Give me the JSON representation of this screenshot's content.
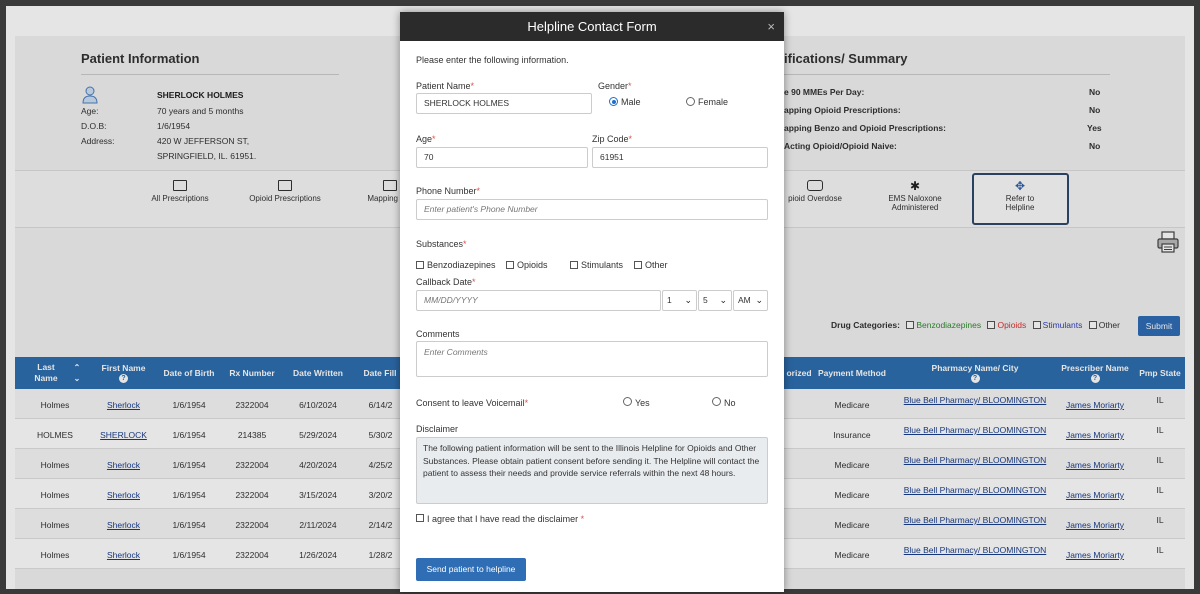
{
  "patient_info": {
    "title": "Patient Information",
    "name": "SHERLOCK HOLMES",
    "age_label": "Age:",
    "age_value": "70 years and 5 months",
    "dob_label": "D.O.B:",
    "dob_value": "1/6/1954",
    "address_label": "Address:",
    "address_line1": "420 W JEFFERSON ST,",
    "address_line2": "SPRINGFIELD, IL. 61951."
  },
  "summary": {
    "title": "ifications/ Summary",
    "rows": [
      {
        "label": "e 90 MMEs Per Day:",
        "value": "No"
      },
      {
        "label": "apping Opioid Prescriptions:",
        "value": "No"
      },
      {
        "label": "apping Benzo and Opioid Prescriptions:",
        "value": "Yes"
      },
      {
        "label": "Acting Opioid/Opioid Naive:",
        "value": "No"
      }
    ]
  },
  "toolbar": {
    "items": [
      {
        "label": "All Prescriptions"
      },
      {
        "label": "Opioid Prescriptions"
      },
      {
        "label": "Mapping Pre"
      },
      {
        "label": "pioid Overdose"
      },
      {
        "label_line1": "EMS Naloxone",
        "label_line2": "Administered"
      },
      {
        "label_line1": "Refer to",
        "label_line2": "Helpline"
      }
    ]
  },
  "filters": {
    "label": "Drug Categories:",
    "options": [
      {
        "label": "Benzodiazepines",
        "color": "#2e8b2e"
      },
      {
        "label": "Opioids",
        "color": "#d9322f"
      },
      {
        "label": "Stimulants",
        "color": "#2f3fb5"
      },
      {
        "label": "Other",
        "color": "#333333"
      }
    ],
    "submit": "Submit"
  },
  "table": {
    "headers": {
      "last_name_1": "Last",
      "last_name_2": "Name",
      "first_name": "First Name",
      "dob": "Date of Birth",
      "rx": "Rx Number",
      "written": "Date Written",
      "filled": "Date Fill",
      "authorized": "orized",
      "payment": "Payment Method",
      "pharmacy": "Pharmacy Name/ City",
      "prescriber": "Prescriber Name",
      "pmp": "Pmp State",
      "help_icon": "?"
    },
    "rows": [
      {
        "last": "Holmes",
        "first": "Sherlock",
        "dob": "1/6/1954",
        "rx": "2322004",
        "written": "6/10/2024",
        "filled": "6/14/2",
        "payment": "Medicare",
        "pharmacy": "Blue Bell Pharmacy/ BLOOMINGTON",
        "prescriber": "James Moriarty",
        "state": "IL"
      },
      {
        "last": "HOLMES",
        "first": "SHERLOCK",
        "dob": "1/6/1954",
        "rx": "214385",
        "written": "5/29/2024",
        "filled": "5/30/2",
        "payment": "Insurance",
        "pharmacy": "Blue Bell Pharmacy/ BLOOMINGTON",
        "prescriber": "James Moriarty",
        "state": "IL"
      },
      {
        "last": "Holmes",
        "first": "Sherlock",
        "dob": "1/6/1954",
        "rx": "2322004",
        "written": "4/20/2024",
        "filled": "4/25/2",
        "payment": "Medicare",
        "pharmacy": "Blue Bell Pharmacy/ BLOOMINGTON",
        "prescriber": "James Moriarty",
        "state": "IL"
      },
      {
        "last": "Holmes",
        "first": "Sherlock",
        "dob": "1/6/1954",
        "rx": "2322004",
        "written": "3/15/2024",
        "filled": "3/20/2",
        "payment": "Medicare",
        "pharmacy": "Blue Bell Pharmacy/ BLOOMINGTON",
        "prescriber": "James Moriarty",
        "state": "IL"
      },
      {
        "last": "Holmes",
        "first": "Sherlock",
        "dob": "1/6/1954",
        "rx": "2322004",
        "written": "2/11/2024",
        "filled": "2/14/2",
        "payment": "Medicare",
        "pharmacy": "Blue Bell Pharmacy/ BLOOMINGTON",
        "prescriber": "James Moriarty",
        "state": "IL"
      },
      {
        "last": "Holmes",
        "first": "Sherlock",
        "dob": "1/6/1954",
        "rx": "2322004",
        "written": "1/26/2024",
        "filled": "1/28/2",
        "payment": "Medicare",
        "pharmacy": "Blue Bell Pharmacy/ BLOOMINGTON",
        "prescriber": "James Moriarty",
        "state": "IL"
      }
    ]
  },
  "modal": {
    "title": "Helpline Contact Form",
    "close": "×",
    "intro": "Please enter the following information.",
    "patient_name_label": "Patient Name",
    "patient_name_value": "SHERLOCK HOLMES",
    "gender_label": "Gender",
    "gender_male": "Male",
    "gender_female": "Female",
    "age_label": "Age",
    "age_value": "70",
    "zip_label": "Zip Code",
    "zip_value": "61951",
    "phone_label": "Phone Number",
    "phone_placeholder": "Enter patient's Phone Number",
    "substances_label": "Substances",
    "substances": [
      "Benzodiazepines",
      "Opioids",
      "Stimulants",
      "Other"
    ],
    "callback_label": "Callback Date",
    "callback_placeholder": "MM/DD/YYYY",
    "hour_value": "1",
    "minute_value": "5",
    "ampm_value": "AM",
    "comments_label": "Comments",
    "comments_placeholder": "Enter Comments",
    "voicemail_label": "Consent to leave Voicemail",
    "voicemail_yes": "Yes",
    "voicemail_no": "No",
    "disclaimer_label": "Disclaimer",
    "disclaimer_text": "The following patient information will be sent to the Illinois Helpline for Opioids and Other Substances. Please obtain patient consent before sending it. The Helpline will contact the patient to assess their needs and provide service referrals within the next 48 hours.",
    "agree_label": "I agree that I have read the disclaimer",
    "required_mark": "*",
    "send_button": "Send patient to helpline"
  }
}
